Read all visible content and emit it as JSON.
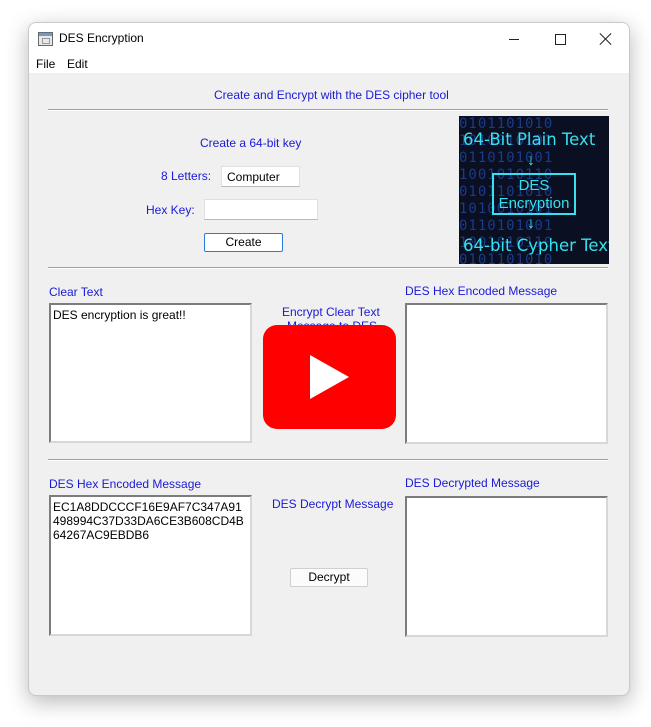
{
  "window": {
    "title": "DES Encryption"
  },
  "menu": {
    "file": "File",
    "edit": "Edit"
  },
  "header": {
    "text": "Create and Encrypt with the DES cipher tool"
  },
  "key_section": {
    "title": "Create a 64-bit key",
    "letters_label": "8 Letters:",
    "letters_value": "Computer",
    "hex_label": "Hex Key:",
    "hex_value": "",
    "create_button": "Create"
  },
  "graphic": {
    "top_text": "64-Bit Plain Text",
    "box_line1": "DES",
    "box_line2": "Encryption",
    "bottom_text": "64-bit Cypher Text",
    "arrow": "↓",
    "bits_text": "0101101010\n1010010101\n0110101001\n1001010110\n0101101010\n1010010101\n0110101001\n1001010110\n0101101010"
  },
  "encrypt_section": {
    "clear_text_label": "Clear Text",
    "clear_text_value": "DES encryption is great!!",
    "encrypt_label": "Encrypt Clear Text",
    "encrypt_label_line2": "Message to DES",
    "hex_encoded_label": "DES Hex Encoded Message",
    "hex_encoded_value": ""
  },
  "decrypt_section": {
    "hex_encoded_label": "DES Hex Encoded Message",
    "hex_encoded_value": "EC1A8DDCCCF16E9AF7C347A91498994C37D33DA6CE3B608CD4B64267AC9EBDB6",
    "decrypt_label": "DES Decrypt Message",
    "decrypt_button": "Decrypt",
    "decrypted_label": "DES Decrypted Message",
    "decrypted_value": ""
  },
  "overlay": {
    "icon": "youtube-play-icon",
    "color": "#ff0000"
  },
  "colors": {
    "label_blue": "#1a1ad6",
    "graphic_cyan": "#35e1ee",
    "graphic_bg": "#0a0f22"
  }
}
